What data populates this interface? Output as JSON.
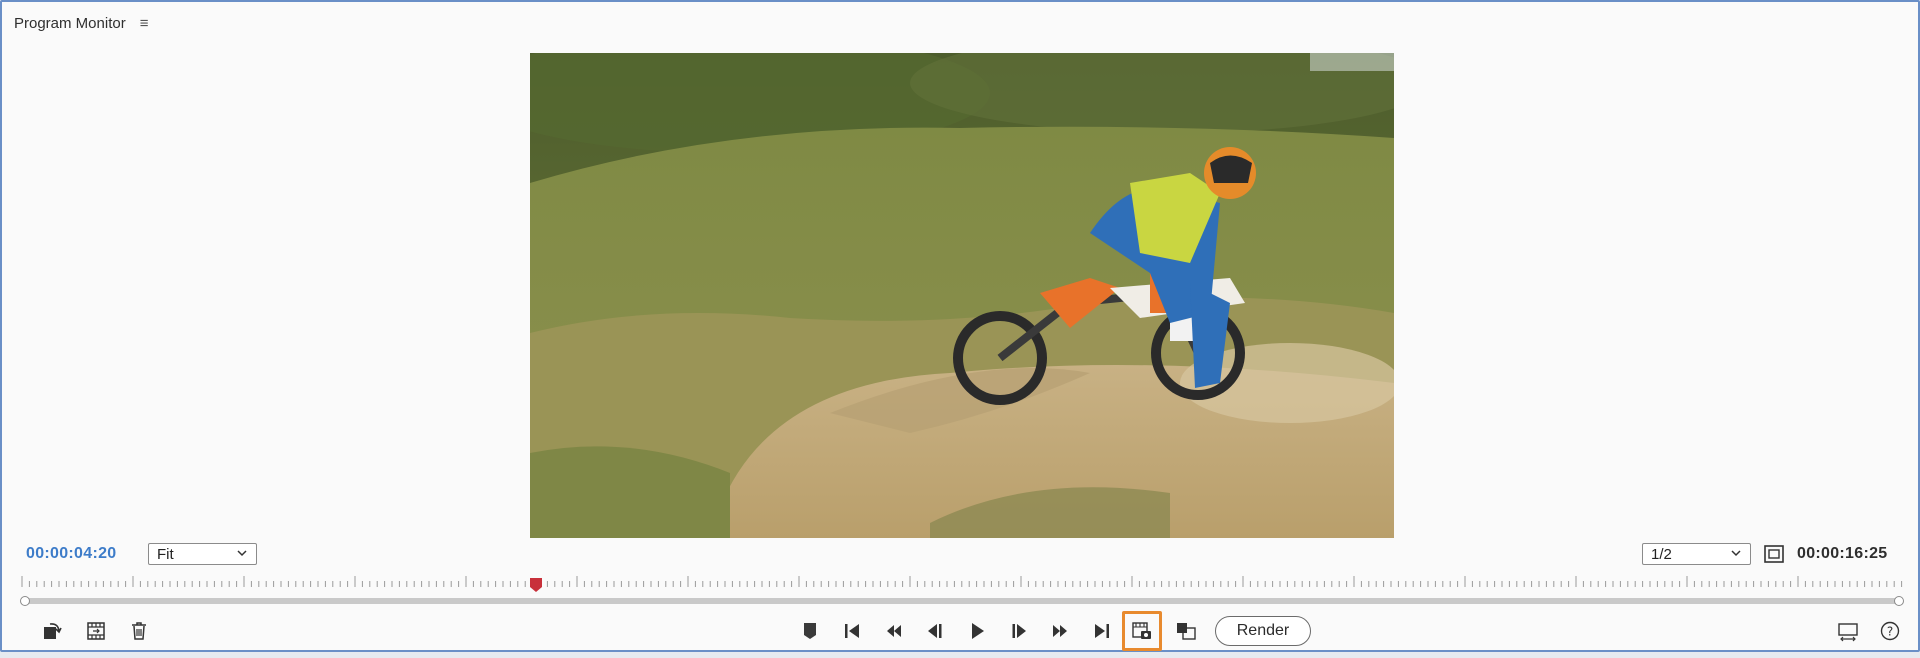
{
  "panel": {
    "title": "Program Monitor",
    "menu_icon": "hamburger-menu-icon"
  },
  "timecode": {
    "current": "00:00:04:20",
    "duration": "00:00:16:25"
  },
  "zoom_select": {
    "value": "Fit"
  },
  "resolution_select": {
    "value": "1/2"
  },
  "playhead_position": 0.274,
  "render_label": "Render",
  "colors": {
    "accent": "#3d7cc9",
    "highlight": "#e88a2e",
    "playhead": "#c8303a",
    "panel_border": "#6a8fc7"
  },
  "left_controls": [
    "rotate-icon",
    "clip-frame-icon",
    "trash-icon"
  ],
  "transport_controls": [
    "add-marker-icon",
    "go-to-in-icon",
    "step-back-icon",
    "step-back-frame-icon",
    "play-icon",
    "step-forward-frame-icon",
    "step-forward-icon",
    "go-to-out-icon",
    "export-frame-icon",
    "compare-view-icon"
  ],
  "right_controls": [
    "button-editor-icon",
    "help-icon"
  ]
}
